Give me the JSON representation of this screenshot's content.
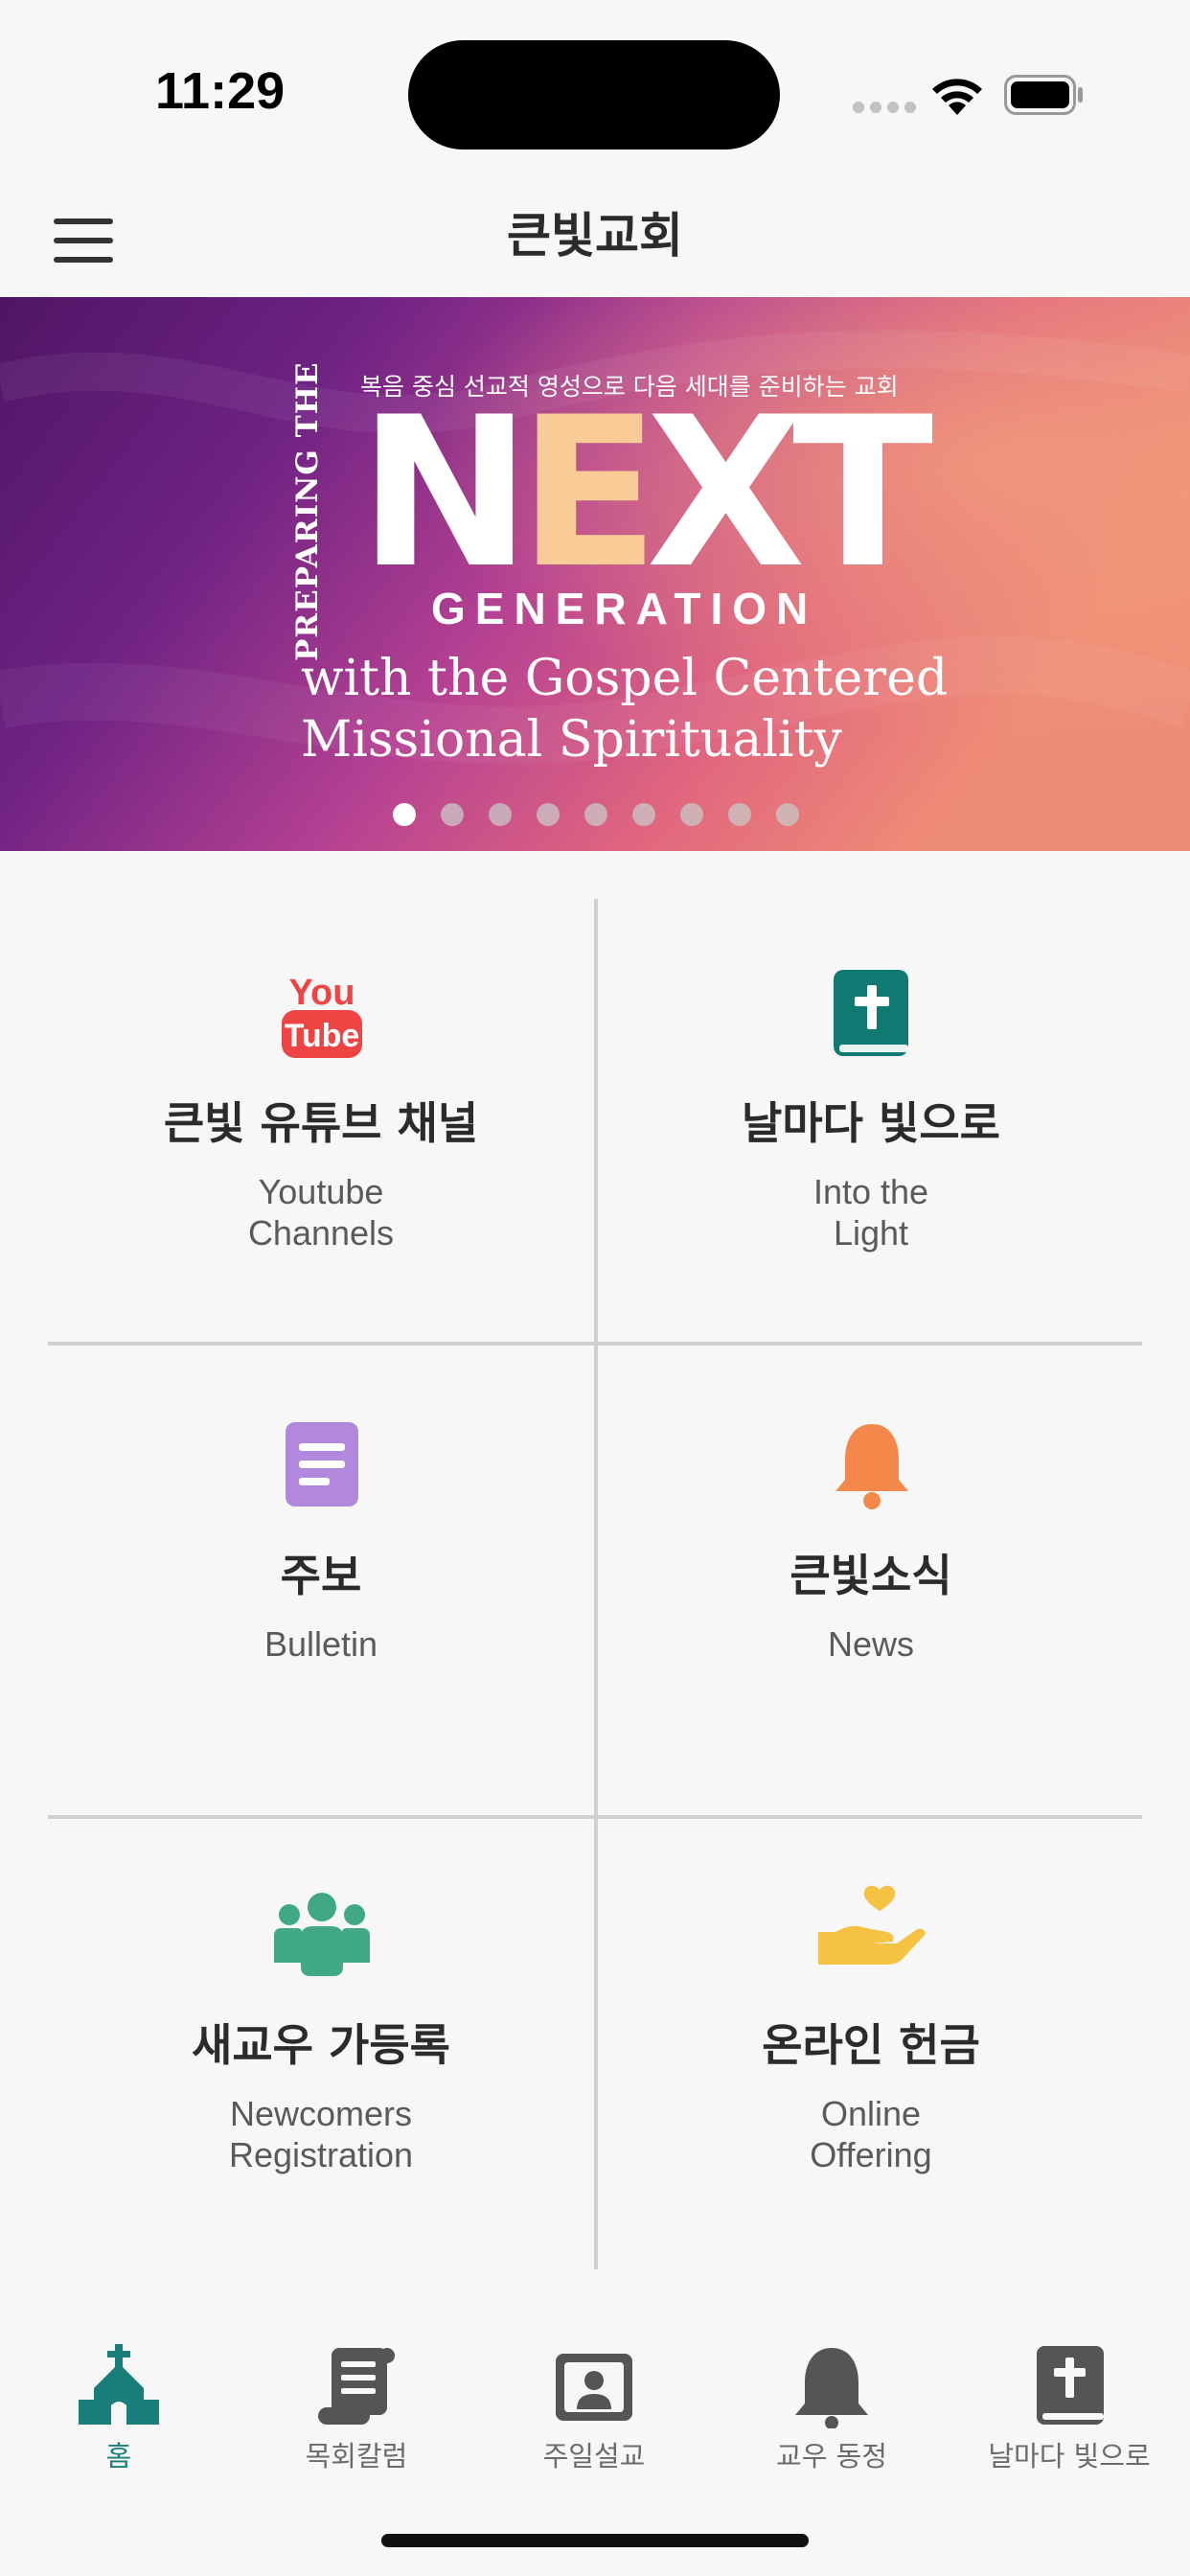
{
  "status_bar": {
    "time": "11:29"
  },
  "app_bar": {
    "title": "큰빛교회"
  },
  "banner": {
    "tagline": "복음 중심 선교적 영성으로 다음 세대를 준비하는 교회",
    "vertical_text": "PREPARING THE",
    "headline_prefix": "N",
    "headline_highlight": "E",
    "headline_suffix": "XT",
    "headline_sub": "GENERATION",
    "line1": "with the Gospel Centered",
    "line2": "Missional Spirituality",
    "slide_count": 9,
    "active_slide": 1
  },
  "menu": [
    {
      "ko": "큰빛 유튜브 채널",
      "en_line1": "Youtube",
      "en_line2": "Channels",
      "icon": "youtube-icon",
      "icon_text_1": "You",
      "icon_text_2": "Tube",
      "color": "#ef4444"
    },
    {
      "ko": "날마다 빛으로",
      "en_line1": "Into the",
      "en_line2": "Light",
      "icon": "bible-icon",
      "color": "#0f7a72"
    },
    {
      "ko": "주보",
      "en_line1": "Bulletin",
      "en_line2": "",
      "icon": "document-icon",
      "color": "#b288dd"
    },
    {
      "ko": "큰빛소식",
      "en_line1": "News",
      "en_line2": "",
      "icon": "bell-icon",
      "color": "#f4884a"
    },
    {
      "ko": "새교우 가등록",
      "en_line1": "Newcomers",
      "en_line2": "Registration",
      "icon": "people-group-icon",
      "color": "#41a884"
    },
    {
      "ko": "온라인 헌금",
      "en_line1": "Online",
      "en_line2": "Offering",
      "icon": "heart-hand-icon",
      "color": "#f6c244"
    }
  ],
  "bottom_nav": [
    {
      "label": "홈",
      "icon": "church-icon",
      "active": true
    },
    {
      "label": "목회칼럼",
      "icon": "scroll-icon",
      "active": false
    },
    {
      "label": "주일설교",
      "icon": "portrait-icon",
      "active": false
    },
    {
      "label": "교우 동정",
      "icon": "bell-icon",
      "active": false
    },
    {
      "label": "날마다 빛으로",
      "icon": "bible-icon",
      "active": false
    }
  ],
  "colors": {
    "accent": "#1a7f7a",
    "nav_inactive": "#555555",
    "background": "#f7f7f7"
  }
}
